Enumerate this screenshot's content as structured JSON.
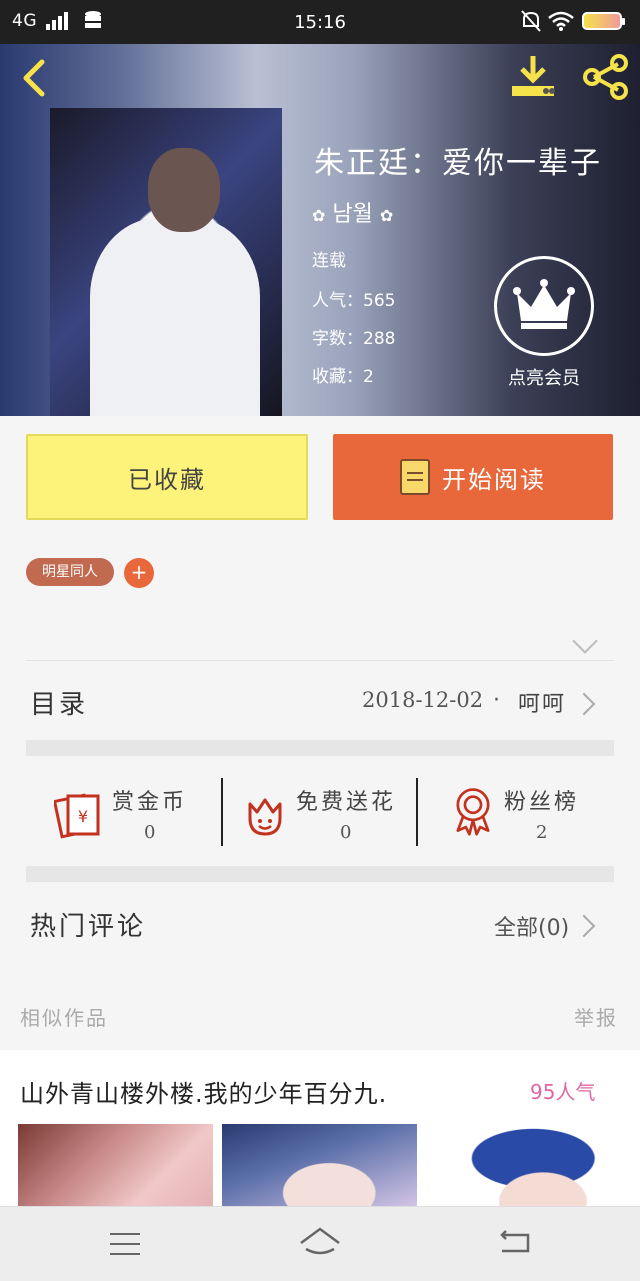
{
  "status_bar": {
    "network": "4G",
    "time": "15:16"
  },
  "book": {
    "title": "朱正廷：爱你一辈子",
    "author": "남월",
    "status": "连载",
    "popularity": "人气：565",
    "word_count": "字数：288",
    "favorites": "收藏：2",
    "vip_label": "点亮会员"
  },
  "actions": {
    "favorited_label": "已收藏",
    "read_label": "开始阅读"
  },
  "tags": [
    "明星同人"
  ],
  "tag_add": "+",
  "toc": {
    "label": "目录",
    "date": "2018-12-02",
    "separator": "·",
    "latest": "呵呵"
  },
  "stats": [
    {
      "label": "赏金币",
      "value": "0",
      "icon": "red-envelope-icon"
    },
    {
      "label": "免费送花",
      "value": "0",
      "icon": "flower-icon"
    },
    {
      "label": "粉丝榜",
      "value": "2",
      "icon": "medal-icon"
    }
  ],
  "comments": {
    "label": "热门评论",
    "all_label": "全部(0)"
  },
  "similar": {
    "label": "相似作品",
    "report": "举报",
    "item_title": "山外青山楼外楼.我的少年百分九.",
    "item_popularity": "95人气"
  },
  "colors": {
    "accent_orange": "#e8683b",
    "favorited_yellow": "#fdf37a",
    "header_icon_yellow": "#f6e24a",
    "popularity_pink": "#e066a6",
    "stat_icon_red": "#c2321e"
  }
}
